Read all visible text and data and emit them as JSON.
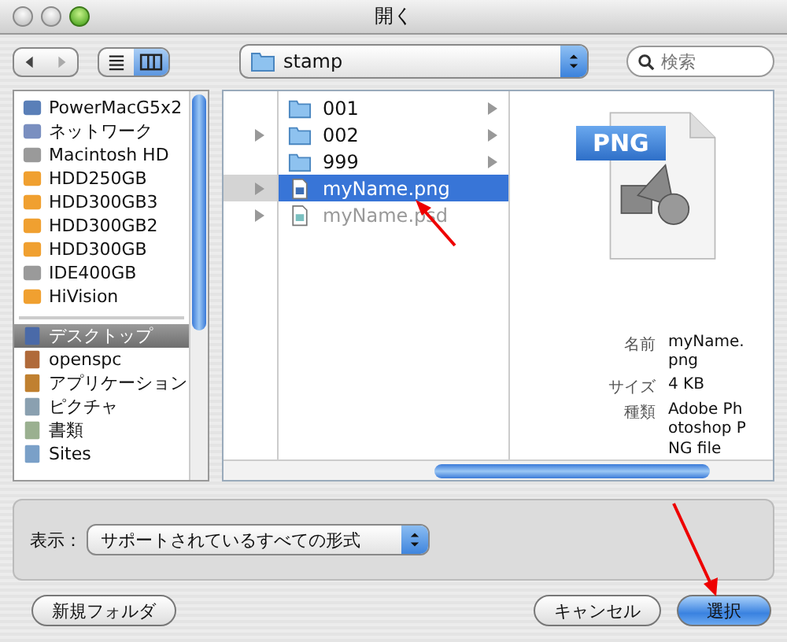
{
  "window": {
    "title": "開く"
  },
  "toolbar": {
    "view_buttons": [
      {
        "kind": "list",
        "selected": false
      },
      {
        "kind": "columns",
        "selected": true
      }
    ],
    "path": "stamp",
    "search": {
      "placeholder": "検索"
    }
  },
  "sidebar": {
    "devices": [
      {
        "name": "PowerMacG5x2",
        "kind": "computer",
        "selected": false
      },
      {
        "name": "ネットワーク",
        "kind": "network",
        "selected": false
      },
      {
        "name": "Macintosh HD",
        "kind": "disk",
        "selected": false
      },
      {
        "name": "HDD250GB",
        "kind": "external",
        "selected": false
      },
      {
        "name": "HDD300GB3",
        "kind": "external",
        "selected": false
      },
      {
        "name": "HDD300GB2",
        "kind": "external",
        "selected": false
      },
      {
        "name": "HDD300GB",
        "kind": "external",
        "selected": false
      },
      {
        "name": "IDE400GB",
        "kind": "disk",
        "selected": false
      },
      {
        "name": "HiVision",
        "kind": "external",
        "selected": false
      }
    ],
    "places": [
      {
        "name": "デスクトップ",
        "kind": "desktop",
        "selected": true
      },
      {
        "name": "openspc",
        "kind": "home",
        "selected": false
      },
      {
        "name": "アプリケーション",
        "kind": "apps",
        "selected": false
      },
      {
        "name": "ピクチャ",
        "kind": "pictures",
        "selected": false
      },
      {
        "name": "書類",
        "kind": "documents",
        "selected": false
      },
      {
        "name": "Sites",
        "kind": "sites",
        "selected": false
      }
    ]
  },
  "browser": {
    "parent_column": [
      {
        "selected": false
      },
      {
        "selected": false
      },
      {
        "selected": false
      },
      {
        "selected": true
      },
      {
        "selected": false
      },
      {
        "selected": false
      },
      {
        "selected": false
      },
      {
        "selected": false
      },
      {
        "selected": false
      },
      {
        "selected": false
      },
      {
        "selected": false
      },
      {
        "selected": false
      }
    ],
    "files": [
      {
        "name": "001",
        "kind": "folder",
        "selected": false,
        "disabled": false
      },
      {
        "name": "002",
        "kind": "folder",
        "selected": false,
        "disabled": false
      },
      {
        "name": "999",
        "kind": "folder",
        "selected": false,
        "disabled": false
      },
      {
        "name": "myName.png",
        "kind": "png",
        "selected": true,
        "disabled": false
      },
      {
        "name": "myName.psd",
        "kind": "psd",
        "selected": false,
        "disabled": true
      }
    ],
    "preview": {
      "badge": "PNG",
      "info": [
        {
          "label": "名前",
          "value": "myName.png"
        },
        {
          "label": "サイズ",
          "value": "4 KB"
        },
        {
          "label": "種類",
          "value": "Adobe Photoshop PNG file"
        }
      ]
    }
  },
  "filter": {
    "label": "表示：",
    "value": "サポートされているすべての形式"
  },
  "buttons": {
    "new_folder": "新規フォルダ",
    "cancel": "キャンセル",
    "choose": "選択"
  }
}
